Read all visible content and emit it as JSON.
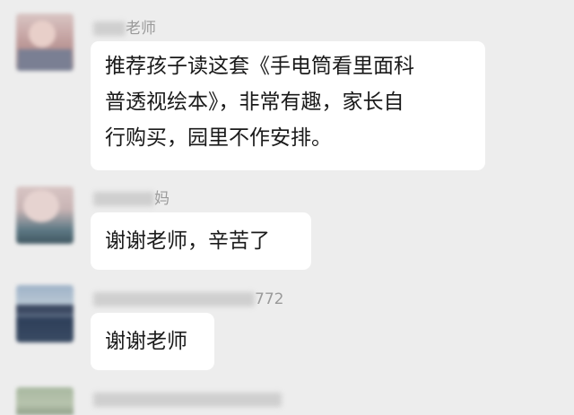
{
  "messages": [
    {
      "sender": "老师",
      "lines": [
        "推荐孩子读这套《手电筒看里面科",
        "普透视绘本》，非常有趣，家长自",
        "行购买，园里不作安排。"
      ]
    },
    {
      "sender": "妈",
      "lines": [
        "谢谢老师，辛苦了"
      ]
    },
    {
      "sender": "772",
      "lines": [
        "谢谢老师"
      ]
    },
    {
      "sender": "",
      "lines": []
    }
  ],
  "colors": {
    "background": "#ededed",
    "bubble": "#ffffff",
    "sender_name": "#9a9a9a",
    "message_text": "#1a1a1a"
  },
  "icons": [
    "avatar-image"
  ]
}
